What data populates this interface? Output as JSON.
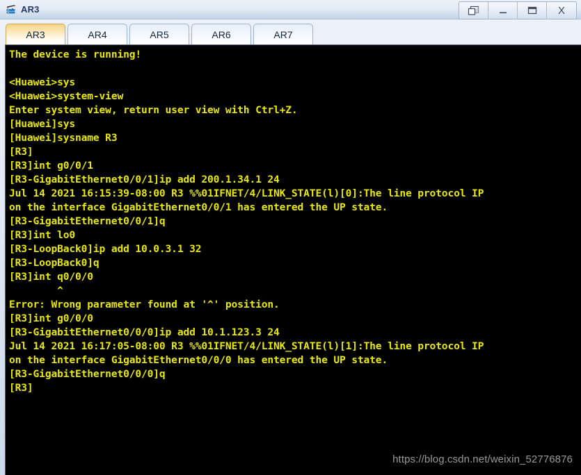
{
  "window": {
    "title": "AR3",
    "icon": "router-icon",
    "controls": [
      {
        "name": "restore-cascade-button",
        "glyph": "cascade"
      },
      {
        "name": "minimize-button",
        "glyph": "minimize"
      },
      {
        "name": "maximize-button",
        "glyph": "maximize"
      },
      {
        "name": "close-button",
        "glyph": "X"
      }
    ]
  },
  "tabs": [
    {
      "label": "AR3",
      "active": true
    },
    {
      "label": "AR4",
      "active": false
    },
    {
      "label": "AR5",
      "active": false
    },
    {
      "label": "AR6",
      "active": false
    },
    {
      "label": "AR7",
      "active": false
    }
  ],
  "terminal": {
    "foreground": "#e8e800",
    "background": "#000000",
    "lines": [
      "The device is running!",
      "",
      "<Huawei>sys",
      "<Huawei>system-view",
      "Enter system view, return user view with Ctrl+Z.",
      "[Huawei]sys",
      "[Huawei]sysname R3",
      "[R3]",
      "[R3]int g0/0/1",
      "[R3-GigabitEthernet0/0/1]ip add 200.1.34.1 24",
      "Jul 14 2021 16:15:39-08:00 R3 %%01IFNET/4/LINK_STATE(l)[0]:The line protocol IP",
      "on the interface GigabitEthernet0/0/1 has entered the UP state.",
      "[R3-GigabitEthernet0/0/1]q",
      "[R3]int lo0",
      "[R3-LoopBack0]ip add 10.0.3.1 32",
      "[R3-LoopBack0]q",
      "[R3]int q0/0/0",
      "        ^",
      "Error: Wrong parameter found at '^' position.",
      "[R3]int g0/0/0",
      "[R3-GigabitEthernet0/0/0]ip add 10.1.123.3 24",
      "Jul 14 2021 16:17:05-08:00 R3 %%01IFNET/4/LINK_STATE(l)[1]:The line protocol IP",
      "on the interface GigabitEthernet0/0/0 has entered the UP state.",
      "[R3-GigabitEthernet0/0/0]q",
      "[R3]"
    ]
  },
  "watermark": {
    "text": "https://blog.csdn.net/weixin_52776876"
  }
}
